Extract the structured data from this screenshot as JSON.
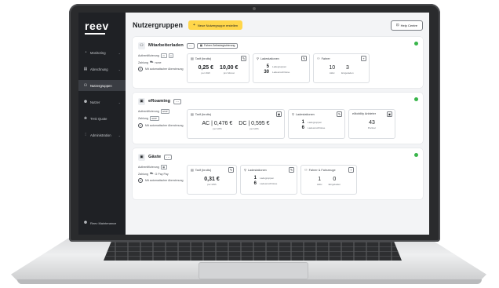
{
  "sidebar": {
    "logo": "reev",
    "items": [
      {
        "label": "Monitoring",
        "icon": "monitor-icon",
        "chevron": true
      },
      {
        "label": "Abrechnung",
        "icon": "invoice-icon",
        "chevron": true
      },
      {
        "label": "Nutzergruppen",
        "icon": "users-icon",
        "chevron": false,
        "active": true
      },
      {
        "label": "Nutzer",
        "icon": "user-icon",
        "chevron": true
      },
      {
        "label": "THG Quote",
        "icon": "leaf-icon",
        "chevron": false
      },
      {
        "label": "Administration",
        "icon": "sliders-icon",
        "chevron": true
      }
    ],
    "footer": "Reev Maintenance"
  },
  "header": {
    "title": "Nutzergruppen",
    "create_label": "Neue Nutzergruppe erstellen",
    "help_label": "Help Centre"
  },
  "groups": [
    {
      "name": "Mitarbeiterladen",
      "menu": "···",
      "tag": "Fahrer-Selbstregistrierung",
      "status_color": "#39b54a",
      "auth_label": "Authentifizierung",
      "auth_badge": "",
      "payment_label": "Zahlung",
      "payment_value": "none",
      "auto_billing": "Mit automatischer Abrechnung",
      "tariff": {
        "title": "Tarif (brutto)",
        "v1": "0,25 €",
        "l1": "per kWh",
        "v2": "10,00 €",
        "l2": "pro Monat"
      },
      "stations": {
        "title": "Ladestationen",
        "n1": "5",
        "l1": "Ladegruppen",
        "n2": "30",
        "l2": "Ladeanschlüsse"
      },
      "third": {
        "title": "Fahrer",
        "v1": "10",
        "l1": "Aktiv",
        "v2": "3",
        "l2": "Eingeladen"
      }
    },
    {
      "name": "eRoaming",
      "menu": "···",
      "tag": "",
      "status_color": "#39b54a",
      "auth_label": "Authentifizierung",
      "auth_badge": "EMP",
      "payment_label": "Zahlung",
      "payment_value": "EMP",
      "auto_billing": "Mit automatischer Abrechnung",
      "tariff": {
        "title": "Tarif (brutto)",
        "v1": "AC | 0,476 €",
        "l1": "per kWh",
        "v2": "DC | 0,595 €",
        "l2": "per kWh"
      },
      "stations": {
        "title": "Ladestationen",
        "n1": "1",
        "l1": "Ladegruppen",
        "n2": "6",
        "l2": "Ladeanschlüsse"
      },
      "third": {
        "title": "eMobility Anbieter",
        "v1": "43",
        "l1": "Partner",
        "v2": "",
        "l2": ""
      }
    },
    {
      "name": "Gäste",
      "menu": "···",
      "tag": "",
      "status_color": "#39b54a",
      "auth_label": "Authentifizierung",
      "auth_badge": "",
      "payment_label": "Zahlung",
      "payment_value": "G Pay  Pay",
      "auto_billing": "Mit automatischer Abrechnung",
      "tariff": {
        "title": "Tarif (brutto)",
        "v1": "0,31 €",
        "l1": "per kWh",
        "v2": "",
        "l2": ""
      },
      "stations": {
        "title": "Ladestationen",
        "n1": "1",
        "l1": "Ladegruppen",
        "n2": "6",
        "l2": "Ladeanschlüsse"
      },
      "third": {
        "title": "Fahrer & Fahrzeuge",
        "v1": "1",
        "l1": "Aktiv",
        "v2": "0",
        "l2": "Eingeladen"
      }
    }
  ]
}
